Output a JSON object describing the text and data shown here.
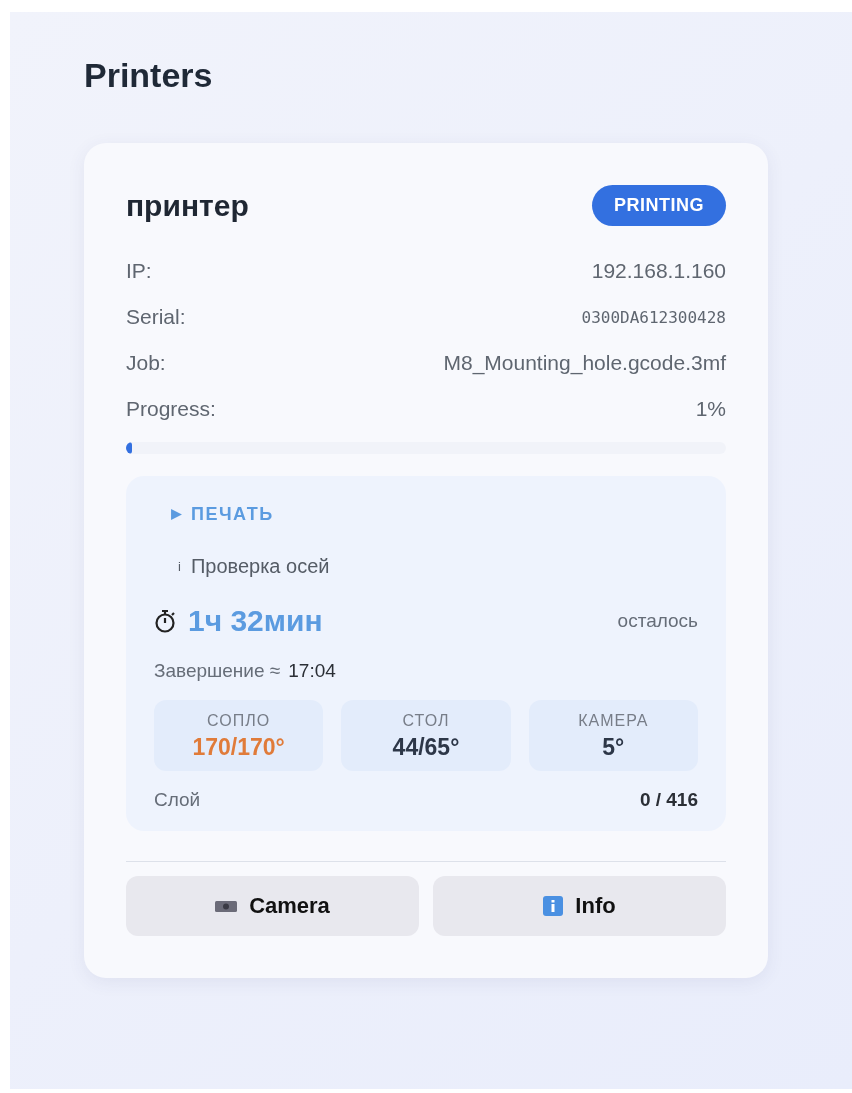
{
  "page": {
    "title": "Printers"
  },
  "printer": {
    "name": "принтер",
    "status": "PRINTING",
    "fields": [
      {
        "label": "IP:",
        "value": "192.168.1.160",
        "kind": "text"
      },
      {
        "label": "Serial:",
        "value": "0300DA612300428",
        "kind": "mono"
      },
      {
        "label": "Job:",
        "value": "M8_Mounting_hole.gcode.3mf",
        "kind": "text"
      },
      {
        "label": "Progress:",
        "value": "1%",
        "kind": "text"
      }
    ],
    "progress": {
      "level": 0.01
    },
    "panel": {
      "stage": "ПЕЧАТЬ",
      "step_icon": "i",
      "step": "Проверка осей",
      "remaining": "1ч 32мин",
      "remaining_label": "осталось",
      "finish_label": "Завершение ≈",
      "finish_time": "17:04",
      "temps": [
        {
          "label": "СОПЛО",
          "value": "170/170°",
          "color": "#e07b39"
        },
        {
          "label": "СТОЛ",
          "value": "44/65°",
          "color": "#2d3748"
        },
        {
          "label": "КАМЕРА",
          "value": "5°",
          "color": "#2d3748"
        }
      ],
      "layer_label": "Слой",
      "layer": "0 / 416"
    },
    "buttons": [
      {
        "label": "Camera",
        "kind": "camera"
      },
      {
        "label": "Info",
        "kind": "info"
      }
    ]
  }
}
